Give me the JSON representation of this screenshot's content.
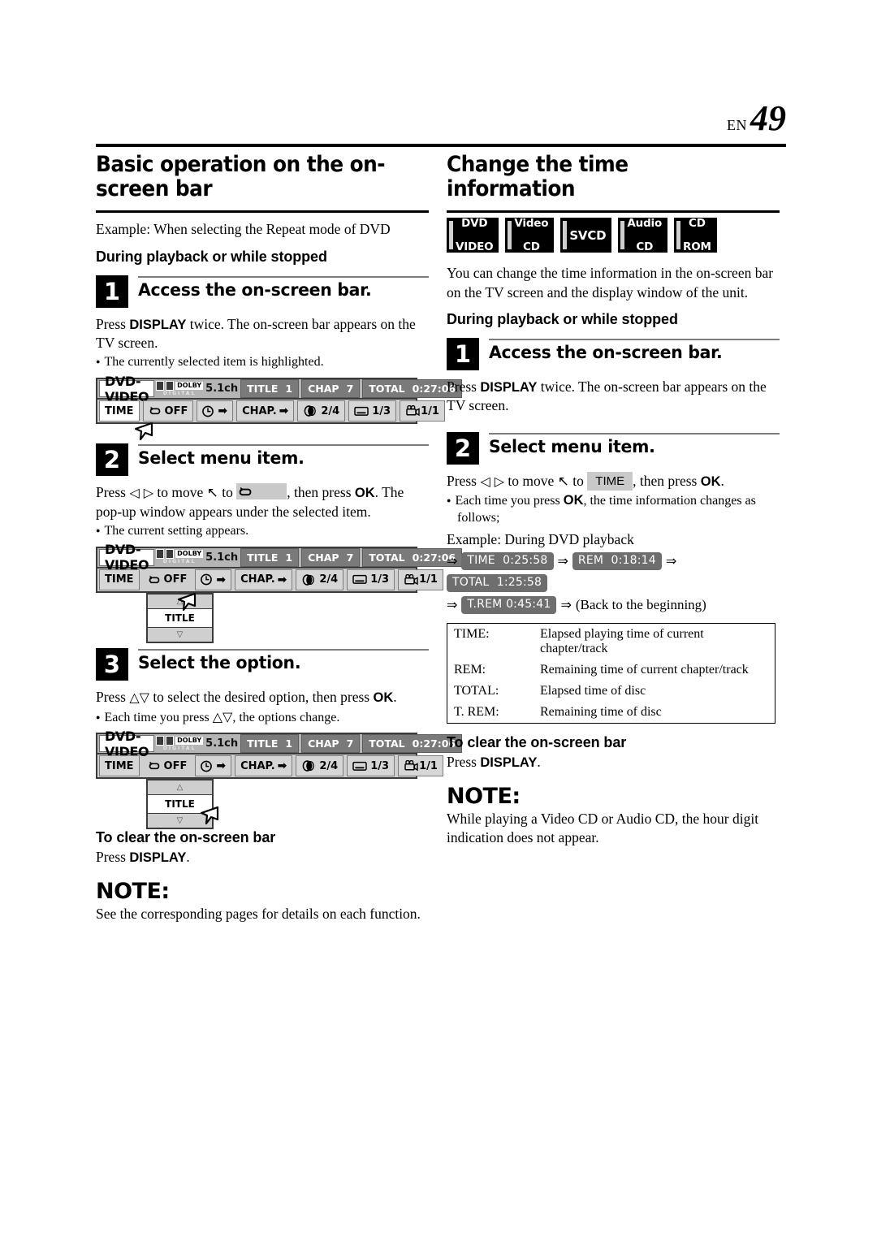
{
  "page": {
    "lang_code": "EN",
    "page_number": "49"
  },
  "left": {
    "title": "Basic operation on the on-screen bar",
    "example_line": "Example: When selecting the Repeat mode of DVD",
    "condition": "During playback or while stopped",
    "steps": [
      {
        "number": "1",
        "title": "Access the on-screen bar.",
        "body_pre": "Press ",
        "body_bold": "DISPLAY",
        "body_post": " twice. The on-screen bar appears on the TV screen.",
        "bullet": "The currently selected item is highlighted."
      },
      {
        "number": "2",
        "title": "Select menu item.",
        "body_1": "Press ",
        "body_2": " to move ",
        "body_3": " to ",
        "body_4": ", then press ",
        "body_bold": "OK",
        "body_5": ". The pop-up window appears under the selected item.",
        "bullet": "The current setting appears."
      },
      {
        "number": "3",
        "title": "Select the option.",
        "body_1": "Press ",
        "body_2": " to select the desired option, then press ",
        "body_bold": "OK",
        "body_3": ".",
        "bullet_1": "Each time you press ",
        "bullet_2": ", the options change."
      }
    ],
    "clear_heading": "To clear the on-screen bar",
    "clear_text_pre": "Press ",
    "clear_text_bold": "DISPLAY",
    "clear_text_post": ".",
    "note_heading": "NOTE:",
    "note_text": "See the corresponding pages for details on each function."
  },
  "right": {
    "title": "Change the time information",
    "disc_badges": [
      {
        "line1": "DVD",
        "line2": "VIDEO"
      },
      {
        "line1": "Video",
        "line2": "CD"
      },
      {
        "line1": "SVCD",
        "line2": ""
      },
      {
        "line1": "Audio",
        "line2": "CD"
      },
      {
        "line1": "CD",
        "line2": "ROM"
      }
    ],
    "intro": "You can change the time information in the on-screen bar on the TV screen and the display window of the unit.",
    "condition": "During playback or while stopped",
    "steps": [
      {
        "number": "1",
        "title": "Access the on-screen bar.",
        "body_pre": "Press ",
        "body_bold": "DISPLAY",
        "body_post": " twice. The on-screen bar appears on the TV screen."
      },
      {
        "number": "2",
        "title": "Select menu item.",
        "body_1": "Press ",
        "body_2": " to move ",
        "body_3": " to ",
        "body_chip": "TIME",
        "body_4": ", then press ",
        "body_bold": "OK",
        "body_5": ".",
        "bullet_1": "Each time you press ",
        "bullet_bold": "OK",
        "bullet_2": ", the time information changes as follows;",
        "example_line": "Example: During DVD playback"
      }
    ],
    "time_sequence": [
      {
        "label": "TIME",
        "value": "0:25:58"
      },
      {
        "label": "REM",
        "value": "0:18:14"
      },
      {
        "label": "TOTAL",
        "value": "1:25:58"
      },
      {
        "label": "T.REM",
        "value": "0:45:41"
      }
    ],
    "sequence_end": "(Back to the beginning)",
    "legend_table": {
      "rows": [
        {
          "key": "TIME:",
          "desc": "Elapsed playing time of current chapter/track"
        },
        {
          "key": "REM:",
          "desc": "Remaining time of current chapter/track"
        },
        {
          "key": "TOTAL:",
          "desc": "Elapsed time of disc"
        },
        {
          "key": "T. REM:",
          "desc": "Remaining time of disc"
        }
      ]
    },
    "clear_heading": "To clear the on-screen bar",
    "clear_text_pre": "Press ",
    "clear_text_bold": "DISPLAY",
    "clear_text_post": ".",
    "note_heading": "NOTE:",
    "note_text": "While playing a Video CD or Audio CD, the hour digit indication does not appear."
  },
  "osb": {
    "disc_label": "DVD-VIDEO",
    "dolby_word": "DOLBY",
    "dolby_sub": "DIGITAL",
    "channels": "5.1ch",
    "title_key": "TITLE",
    "title_val": "1",
    "chap_key": "CHAP",
    "chap_val": "7",
    "total_key": "TOTAL",
    "total_val": "0:27:06",
    "btn_time": "TIME",
    "btn_repeat": "OFF",
    "btn_chap": "CHAP.",
    "btn_audio": "2/4",
    "btn_subtitle": "1/3",
    "btn_angle": "1/1",
    "popup_option": "TITLE"
  },
  "glyphs": {
    "left_right": "◁ ▷",
    "up_down": "△▽",
    "pointer": "↖",
    "rarrow": "⇒",
    "play": "▶",
    "up_tri": "△",
    "down_tri": "▽"
  }
}
